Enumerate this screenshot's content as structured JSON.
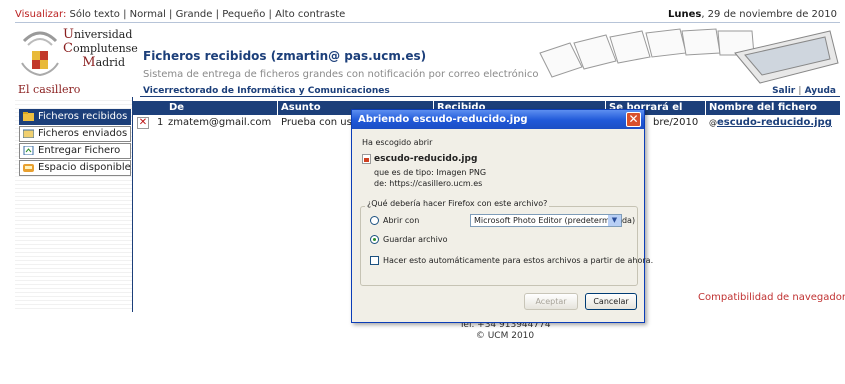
{
  "accessibility_bar": {
    "visualize_label": "Visualizar:",
    "text_only": "Sólo texto",
    "separator": "|",
    "normal": "Normal",
    "large": "Grande",
    "small": "Pequeño",
    "high_contrast": "Alto contraste",
    "date_day": "Lunes",
    "date_rest": ", 29 de noviembre de 2010"
  },
  "header": {
    "logo_line1_cap": "U",
    "logo_line1": "niversidad",
    "logo_line2_cap": "C",
    "logo_line2": "omplutense",
    "logo_line3_cap": "M",
    "logo_line3": "adrid",
    "title": "Ficheros recibidos (zmartin@ pas.ucm.es)",
    "subtitle": "Sistema de entrega de ficheros grandes con notificación por correo electrónico"
  },
  "strip": {
    "brand": "El casillero",
    "vice": "Vicerrectorado de Informática y Comunicaciones",
    "logout": "Salir",
    "help": "Ayuda"
  },
  "nav": {
    "items": [
      {
        "label": "Ficheros recibidos"
      },
      {
        "label": "Ficheros enviados"
      },
      {
        "label": "Entregar Fichero"
      },
      {
        "label": "Espacio disponible"
      }
    ]
  },
  "table": {
    "headers": {
      "de": "De",
      "asunto": "Asunto",
      "recibido": "Recibido",
      "borrara": "Se borrará el",
      "fichero": "Nombre del fichero"
    },
    "rows": [
      {
        "num": "1",
        "from": "zmatem@gmail.com",
        "subject": "Prueba con usu",
        "delete_date": "bre/2010",
        "filename": "escudo-reducido.jpg"
      }
    ]
  },
  "compat_link": "Compatibilidad de navegadores",
  "footer": {
    "phone": "Tel. +34 913944774",
    "copyright": "© UCM 2010"
  },
  "dialog": {
    "title": "Abriendo escudo-reducido.jpg",
    "close": "✕",
    "chosen_label": "Ha escogido abrir",
    "filename": "escudo-reducido.jpg",
    "type_label": "que es de tipo:",
    "type_value": "Imagen PNG",
    "from_label": "de:",
    "from_value": "https://casillero.ucm.es",
    "question": "¿Qué debería hacer Firefox con este archivo?",
    "open_with_label": "Abrir con",
    "open_with_app": "Microsoft Photo Editor (predeterminada)",
    "save_label": "Guardar archivo",
    "auto_label": "Hacer esto automáticamente para estos archivos a partir de ahora.",
    "accept": "Aceptar",
    "cancel": "Cancelar"
  },
  "colors": {
    "navy": "#1c3f7a",
    "brand_red": "#8a1f1f",
    "xp_title": "#1f58d8"
  }
}
